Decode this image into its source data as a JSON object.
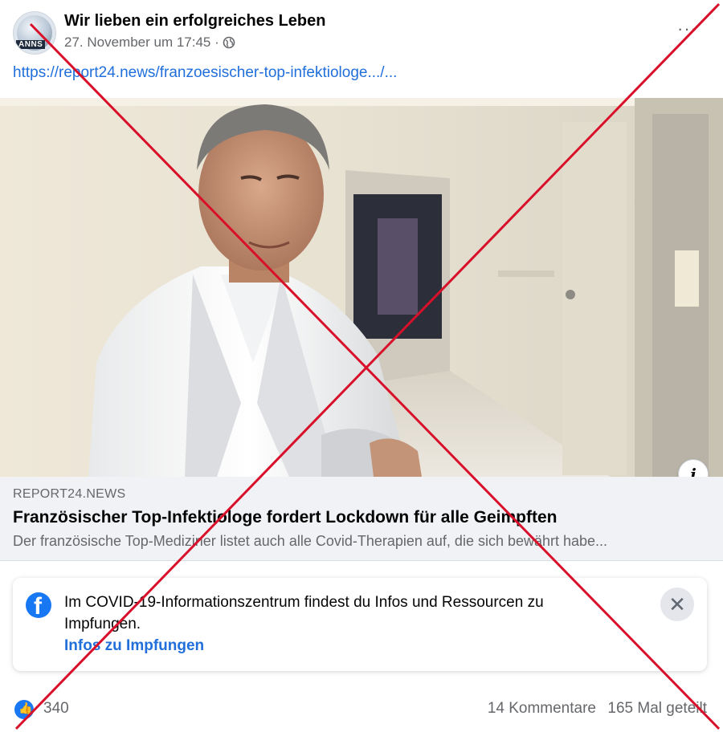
{
  "post": {
    "page_name": "Wir lieben ein erfolgreiches Leben",
    "timestamp": "27. November um 17:45 ·",
    "avatar_text": "ANNS",
    "link": "https://report24.news/franzoesischer-top-infektiologe.../..."
  },
  "preview": {
    "domain": "REPORT24.NEWS",
    "title": "Französischer Top-Infektiologe fordert Lockdown für alle Geimpften",
    "description": "Der französische Top-Mediziner listet auch alle Covid-Therapien auf, die sich bewährt habe..."
  },
  "covid_card": {
    "text": "Im COVID-19-Informationszentrum findest du Infos und Ressourcen zu Impfungen.",
    "link": "Infos zu Impfungen"
  },
  "footer": {
    "reactions": "340",
    "comments": "14 Kommentare",
    "shares": "165 Mal geteilt"
  },
  "icons": {
    "info": "i",
    "close": "✕",
    "more": "···"
  },
  "colors": {
    "link": "#216fdb",
    "cross": "#d9102a",
    "facebook_blue": "#1877f2"
  }
}
